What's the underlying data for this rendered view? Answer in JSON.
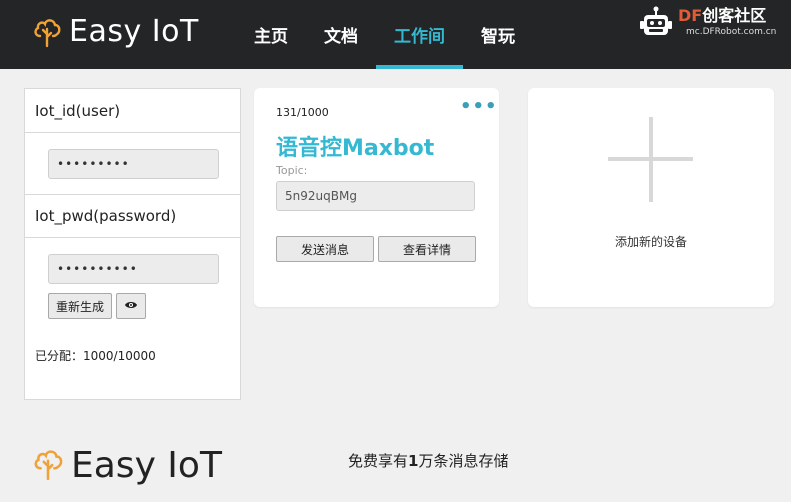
{
  "header": {
    "logo_text": "Easy IoT",
    "nav": [
      {
        "label": "主页"
      },
      {
        "label": "文档"
      },
      {
        "label": "工作间"
      },
      {
        "label": "智玩"
      }
    ],
    "active_nav": 2,
    "brand": {
      "df": "DF",
      "name": "创客社区",
      "url": "mc.DFRobot.com.cn"
    }
  },
  "credentials": {
    "id_label": "Iot_id(user)",
    "id_value": "•••••••••",
    "pwd_label": "Iot_pwd(password)",
    "pwd_value": "••••••••••",
    "regenerate_label": "重新生成",
    "show_label": "👁",
    "assigned_label": "已分配：",
    "assigned_value": "1000/10000"
  },
  "device_card": {
    "count": "131/1000",
    "more": "•••",
    "name": "语音控Maxbot",
    "topic_label": "Topic:",
    "topic_value": "5n92uqBMg",
    "send_label": "发送消息",
    "detail_label": "查看详情"
  },
  "add_card": {
    "label": "添加新的设备"
  },
  "footer": {
    "logo_text": "Easy IoT",
    "note_prefix": "免费享有",
    "note_bold": "1",
    "note_suffix": "万条消息存储"
  },
  "colors": {
    "accent": "#35b8d2",
    "header_bg": "#232526",
    "logo_orange": "#f0a236",
    "df_red": "#e35a36"
  }
}
